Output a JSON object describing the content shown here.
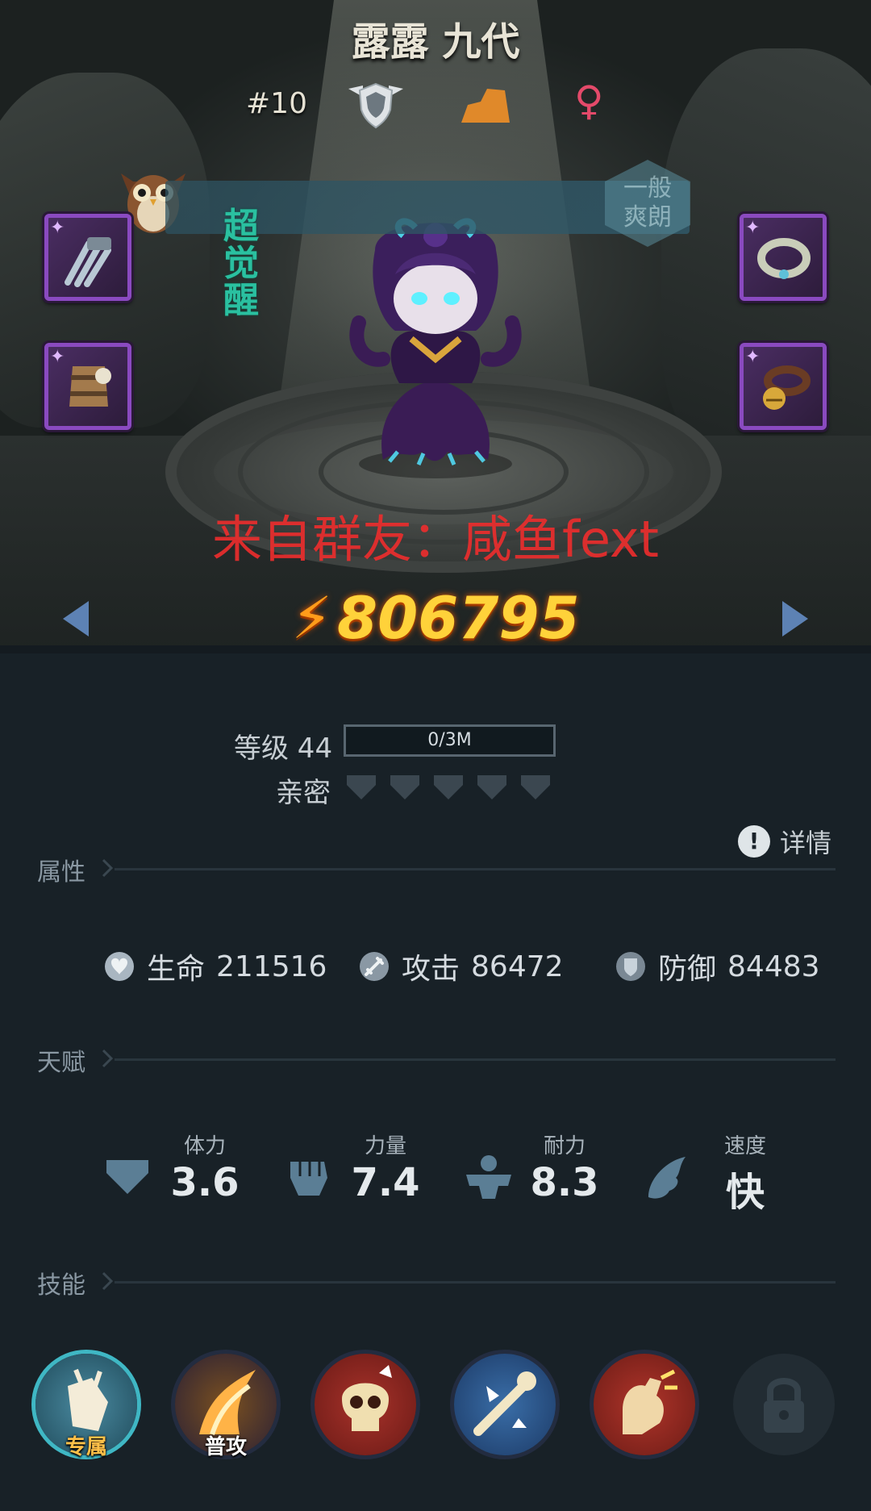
{
  "hero": {
    "name": "露露 九代",
    "rank": "#10",
    "gender_symbol": "♀",
    "banner_tag": "一般\n爽朗",
    "awaken_tag": "超觉醒",
    "power": "806795",
    "watermark": "来自群友：咸鱼fext"
  },
  "progress": {
    "level_label": "等级 44",
    "xp_text": "0/3M",
    "intimacy_label": "亲密",
    "intimacy_hearts_filled": 0,
    "intimacy_hearts_total": 5
  },
  "detail_label": "详情",
  "sections": {
    "attributes": "属性",
    "talents": "天赋",
    "skills": "技能"
  },
  "attributes": [
    {
      "icon": "heart-shield-icon",
      "name": "生命",
      "value": "211516"
    },
    {
      "icon": "sword-icon",
      "name": "攻击",
      "value": "86472"
    },
    {
      "icon": "shield-icon",
      "name": "防御",
      "value": "84483"
    }
  ],
  "talents": [
    {
      "icon": "heart-icon",
      "name": "体力",
      "value": "3.6"
    },
    {
      "icon": "fist-icon",
      "name": "力量",
      "value": "7.4"
    },
    {
      "icon": "muscle-icon",
      "name": "耐力",
      "value": "8.3"
    },
    {
      "icon": "wing-icon",
      "name": "速度",
      "value": "快"
    }
  ],
  "skills": [
    {
      "icon": "exclusive-skill-icon",
      "label": "专属",
      "locked": false
    },
    {
      "icon": "basic-attack-icon",
      "label": "普攻",
      "locked": false
    },
    {
      "icon": "skull-icon",
      "label": "",
      "locked": false
    },
    {
      "icon": "bone-strike-icon",
      "label": "",
      "locked": false
    },
    {
      "icon": "arm-flex-icon",
      "label": "",
      "locked": false
    },
    {
      "icon": "lock-icon",
      "label": "",
      "locked": true
    }
  ],
  "colors": {
    "background": "#182127",
    "power": "#ffd23a",
    "equipment_border": "#8a4ac0",
    "gender": "#e44a6a",
    "watermark": "#ee2d2d"
  }
}
